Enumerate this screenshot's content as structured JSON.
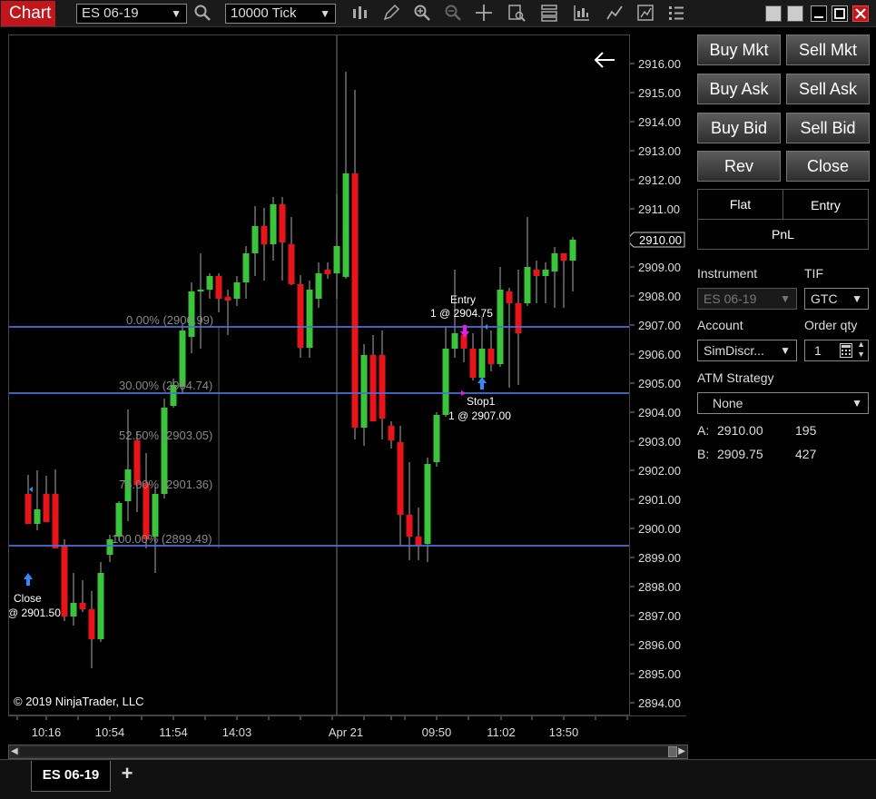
{
  "toolbar": {
    "title": "Chart",
    "instrument": "ES 06-19",
    "interval": "10000 Tick"
  },
  "chart": {
    "copyright": "© 2019 NinjaTrader, LLC",
    "price_axis": [
      "2916.00",
      "2915.00",
      "2914.00",
      "2913.00",
      "2912.00",
      "2911.00",
      "2909.00",
      "2908.00",
      "2907.00",
      "2906.00",
      "2905.00",
      "2904.00",
      "2903.00",
      "2902.00",
      "2901.00",
      "2900.00",
      "2899.00",
      "2898.00",
      "2897.00",
      "2896.00",
      "2895.00",
      "2894.00"
    ],
    "last_price": "2910.00",
    "time_axis": [
      "10:16",
      "10:54",
      "11:54",
      "14:03",
      "Apr 21",
      "09:50",
      "11:02",
      "13:50"
    ],
    "fib_levels": [
      "0.00% (2906.99)",
      "30.00% (2904.74)",
      "52.50% (2903.05)",
      "75.00% (2901.36)",
      "100.00% (2899.49)"
    ],
    "annotations": {
      "close_label": "Close",
      "close_price": "@ 2901.50",
      "entry_label": "Entry",
      "entry_price": "1 @ 2904.75",
      "stop_label": "Stop1",
      "stop_price": "1 @ 2907.00"
    },
    "colors": {
      "up": "#39c439",
      "down": "#e8141a",
      "fib": "#4a6fd9",
      "marker_long": "#2e8cff",
      "marker_short": "#e020e0"
    }
  },
  "tabs": {
    "active": "ES 06-19",
    "add": "+"
  },
  "panel": {
    "buy_mkt": "Buy Mkt",
    "sell_mkt": "Sell Mkt",
    "buy_ask": "Buy Ask",
    "sell_ask": "Sell Ask",
    "buy_bid": "Buy Bid",
    "sell_bid": "Sell Bid",
    "rev": "Rev",
    "close": "Close",
    "flat": "Flat",
    "entry": "Entry",
    "pnl": "PnL",
    "instrument_label": "Instrument",
    "instrument_value": "ES 06-19",
    "tif_label": "TIF",
    "tif_value": "GTC",
    "account_label": "Account",
    "account_value": "SimDiscr...",
    "order_qty_label": "Order qty",
    "order_qty_value": "1",
    "atm_label": "ATM Strategy",
    "atm_value": "None",
    "ask_label": "A:",
    "ask_price": "2910.00",
    "ask_size": "195",
    "bid_label": "B:",
    "bid_price": "2909.75",
    "bid_size": "427"
  }
}
